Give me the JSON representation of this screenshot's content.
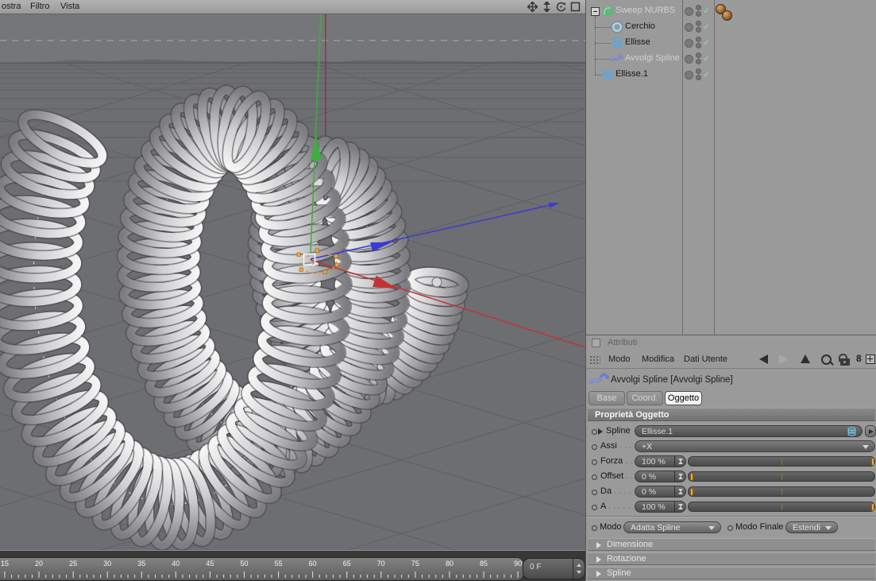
{
  "window": {
    "left_menu": [
      "ostra",
      "Filtro",
      "Vista"
    ]
  },
  "viewport": {
    "nav_icons": [
      "pan-icon",
      "dolly-icon",
      "rotate-icon",
      "maximize-icon"
    ],
    "axis_colors": {
      "x": "#c23434",
      "y": "#3fae3f",
      "z": "#3b3bcf"
    },
    "selection_accent": "#f0a838",
    "timeline": {
      "tick_start": 15,
      "tick_end": 90,
      "tick_step": 5,
      "frame_value": "0 F"
    }
  },
  "object_manager": {
    "items": [
      {
        "label": "Sweep NURBS",
        "icon": "sweep-nurbs-icon",
        "depth": 0,
        "expanded": true,
        "highlight": true,
        "enabled": true,
        "tags": 2
      },
      {
        "label": "Cerchio",
        "icon": "circle-spline-icon",
        "depth": 1,
        "highlight": false,
        "enabled": true,
        "tags": 0
      },
      {
        "label": "Ellisse",
        "icon": "ellipse-spline-icon",
        "depth": 1,
        "highlight": false,
        "enabled": true,
        "tags": 0
      },
      {
        "label": "Avvolgi Spline",
        "icon": "wrap-spline-icon",
        "depth": 1,
        "highlight": true,
        "enabled": true,
        "tags": 0
      },
      {
        "label": "Ellisse.1",
        "icon": "ellipse-spline-icon",
        "depth": 0,
        "highlight": false,
        "enabled": true,
        "tags": 0
      }
    ]
  },
  "attributes": {
    "title": "Attributi",
    "menu": [
      "Modo",
      "Modifica",
      "Dati Utente"
    ],
    "object_label": "Avvolgi Spline [Avvolgi Spline]",
    "tabs": [
      "Base",
      "Coord.",
      "Oggetto"
    ],
    "active_tab": "Oggetto",
    "section_header": "Proprietà Oggetto",
    "rows": {
      "spline": {
        "label": "Spline",
        "value": "Ellisse.1"
      },
      "assi": {
        "label": "Assi",
        "leader": ". . .",
        "value": "+X"
      },
      "forza": {
        "label": "Forza",
        "leader": ". .",
        "value": "100 %",
        "percent": 100
      },
      "offset": {
        "label": "Offset",
        "leader": ". .",
        "value": "0 %",
        "percent": 0
      },
      "da": {
        "label": "Da",
        "leader": ". . . .",
        "value": "0 %",
        "percent": 0
      },
      "a": {
        "label": "A",
        "leader": ". . . . .",
        "value": "100 %",
        "percent": 100
      }
    },
    "modo": {
      "label": "Modo",
      "value": "Adatta Spline"
    },
    "modo_finale": {
      "label": "Modo Finale",
      "value": "Estendi"
    },
    "collapsed_sections": [
      "Dimensione",
      "Rotazione",
      "Spline"
    ]
  },
  "colors": {
    "orange_marker": "#f2a93c",
    "check_green": "#8fd8a8"
  }
}
